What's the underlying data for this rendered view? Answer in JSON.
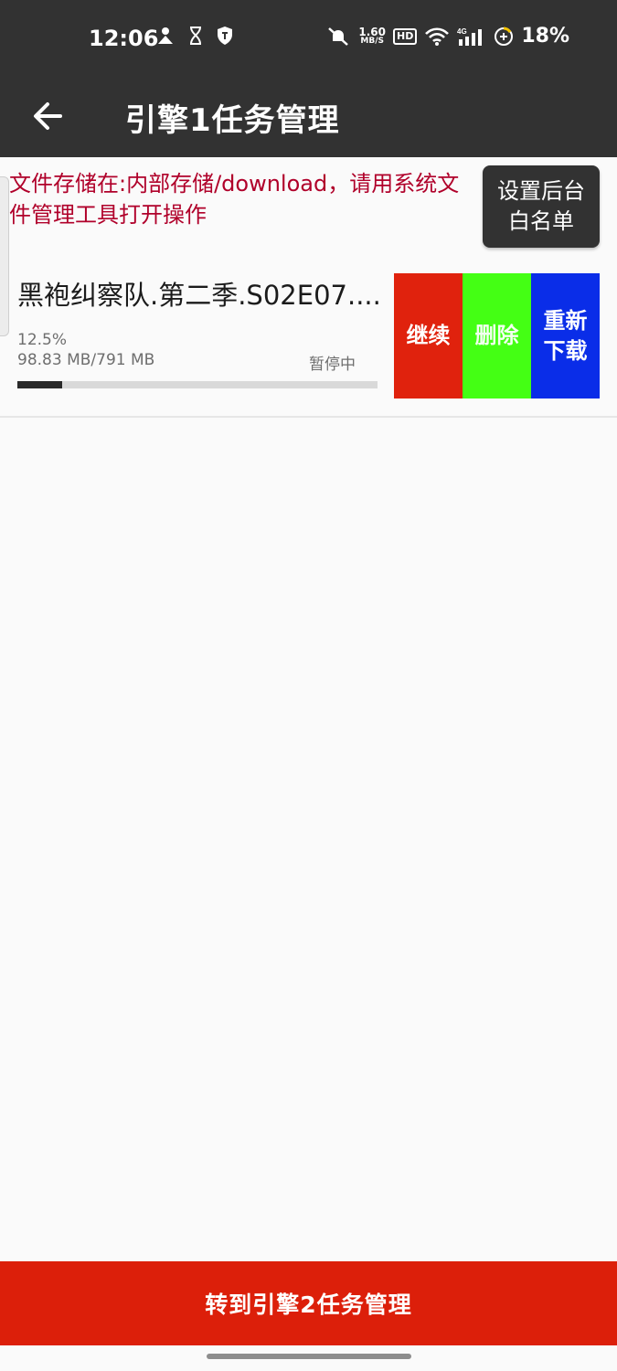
{
  "status_bar": {
    "time": "12:06",
    "net_speed": "1.60",
    "net_unit": "MB/S",
    "hd_label": "HD",
    "network_type": "4G",
    "battery": "18%"
  },
  "appbar": {
    "title": "引擎1任务管理"
  },
  "notice": {
    "text": "文件存储在:内部存储/download，请用系统文件管理工具打开操作"
  },
  "whitelist_button": {
    "line1": "设置后台",
    "line2": "白名单"
  },
  "task": {
    "name": "黑袍纠察队.第二季.S02E07....",
    "percent_text": "12.5%",
    "progress": 0.125,
    "size_text": "98.83 MB/791 MB",
    "status": "暂停中",
    "actions": {
      "continue": "继续",
      "delete": "删除",
      "redownload_line1": "重新",
      "redownload_line2": "下载"
    }
  },
  "bottom_button": {
    "label": "转到引擎2任务管理"
  },
  "colors": {
    "bar_bg": "#323232",
    "notice_red": "#b0002a",
    "continue_red": "#e0220d",
    "delete_green": "#44ff14",
    "redownload_blue": "#0a2de8",
    "bottom_red": "#dc1f0a"
  }
}
